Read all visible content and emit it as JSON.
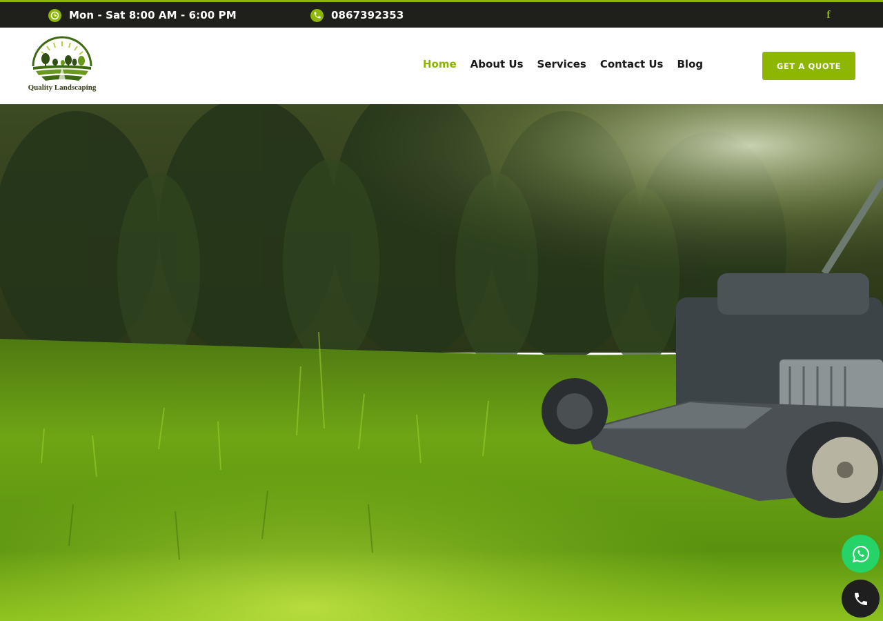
{
  "topbar": {
    "hours_text": "Mon - Sat 8:00 AM - 6:00 PM",
    "hours_icon": "clock-icon",
    "phone_text": "0867392353",
    "phone_icon": "phone-icon",
    "social_icon": "facebook-icon"
  },
  "header": {
    "logo_text": "Quality Landscaping",
    "nav": [
      {
        "label": "Home",
        "active": true
      },
      {
        "label": "About Us",
        "active": false
      },
      {
        "label": "Services",
        "active": false
      },
      {
        "label": "Contact Us",
        "active": false
      },
      {
        "label": "Blog",
        "active": false
      }
    ],
    "cta_label": "GET A QUOTE"
  },
  "hero": {
    "image": "lawn-mower-cutting-grass-photo"
  },
  "floating": {
    "whatsapp_icon": "whatsapp-icon",
    "call_icon": "phone-icon"
  },
  "colors": {
    "accent": "#8db600",
    "topbar_bg": "#1f1f1b",
    "whatsapp": "#25d366",
    "call_bg": "#1f1f1f"
  }
}
